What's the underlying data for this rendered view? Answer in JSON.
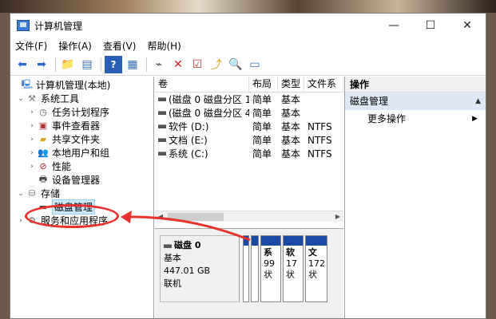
{
  "window": {
    "title": "计算机管理",
    "minimize": "—",
    "maximize": "☐",
    "close": "✕"
  },
  "menu": [
    "文件(F)",
    "操作(A)",
    "查看(V)",
    "帮助(H)"
  ],
  "tree": {
    "items": [
      {
        "label": "计算机管理(本地)",
        "expander": "",
        "icon": "computer-icon"
      },
      {
        "label": "系统工具",
        "expander": "⌄",
        "icon": "tools-icon"
      },
      {
        "label": "任务计划程序",
        "expander": "›",
        "icon": "clock-icon"
      },
      {
        "label": "事件查看器",
        "expander": "›",
        "icon": "event-icon"
      },
      {
        "label": "共享文件夹",
        "expander": "›",
        "icon": "share-folder-icon"
      },
      {
        "label": "本地用户和组",
        "expander": "›",
        "icon": "users-icon"
      },
      {
        "label": "性能",
        "expander": "›",
        "icon": "performance-icon"
      },
      {
        "label": "设备管理器",
        "expander": "",
        "icon": "device-manager-icon"
      },
      {
        "label": "存储",
        "expander": "⌄",
        "icon": "storage-icon"
      },
      {
        "label": "磁盘管理",
        "expander": "",
        "icon": "disk-icon"
      },
      {
        "label": "服务和应用程序",
        "expander": "›",
        "icon": "services-icon"
      }
    ]
  },
  "volumes": {
    "headers": [
      "卷",
      "布局",
      "类型",
      "文件系"
    ],
    "rows": [
      [
        "(磁盘 0 磁盘分区 1)",
        "简单",
        "基本",
        ""
      ],
      [
        "(磁盘 0 磁盘分区 4)",
        "简单",
        "基本",
        ""
      ],
      [
        "软件 (D:)",
        "简单",
        "基本",
        "NTFS"
      ],
      [
        "文档 (E:)",
        "简单",
        "基本",
        "NTFS"
      ],
      [
        "系统 (C:)",
        "简单",
        "基本",
        "NTFS"
      ]
    ]
  },
  "disk": {
    "name": "磁盘 0",
    "type": "基本",
    "size": "447.01 GB",
    "status": "联机",
    "partitions": [
      {
        "l1": "",
        "l2": "",
        "l3": ""
      },
      {
        "l1": "",
        "l2": "",
        "l3": ""
      },
      {
        "l1": "系",
        "l2": "99",
        "l3": "状"
      },
      {
        "l1": "软",
        "l2": "17",
        "l3": "状"
      },
      {
        "l1": "文",
        "l2": "172",
        "l3": "状"
      }
    ]
  },
  "actions": {
    "header": "操作",
    "section": "磁盘管理",
    "item": "更多操作"
  },
  "colors": {
    "partition_bar": "#1a4aa6",
    "annotation": "#e8322b",
    "selection": "#cce8ff"
  }
}
